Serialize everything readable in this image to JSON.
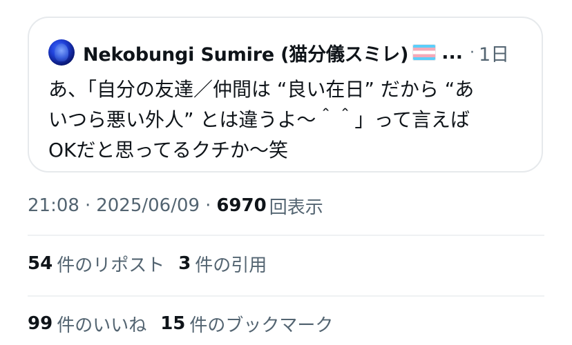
{
  "quote": {
    "author": "Nekobungi Sumire (猫分儀スミレ)",
    "ellipsis": "...",
    "separator": "·",
    "time_ago": "1日",
    "lines": [
      "あ、「自分の友達／仲間は “良い在日” だから “あ",
      "いつら悪い外人” とは違うよ〜＾＾」って言えば",
      "OKだと思ってるクチか〜笑"
    ]
  },
  "meta": {
    "time": "21:08",
    "sep1": "·",
    "date": "2025/06/09",
    "sep2": "·",
    "views_count": "6970",
    "views_label": "回表示"
  },
  "stats": {
    "reposts_count": "54",
    "reposts_label": "件のリポスト",
    "quotes_count": "3",
    "quotes_label": "件の引用",
    "likes_count": "99",
    "likes_label": "件のいいね",
    "bookmarks_count": "15",
    "bookmarks_label": "件のブックマーク"
  },
  "icons": {
    "avatar": "avatar-image",
    "flag": "transgender-flag-icon"
  },
  "colors": {
    "text_primary": "#0f1419",
    "text_secondary": "#536471",
    "border": "#e6e9ec"
  }
}
